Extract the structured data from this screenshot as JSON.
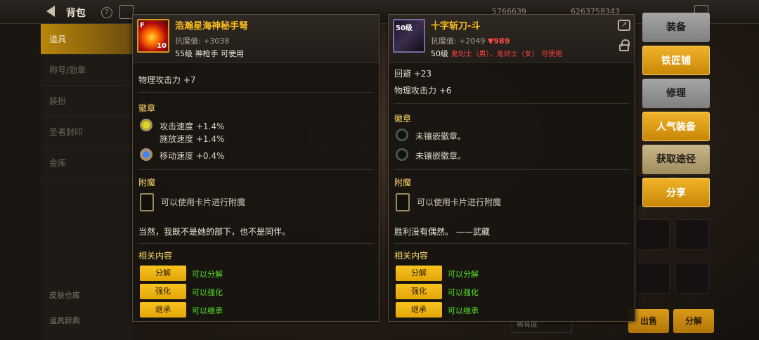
{
  "topbar": {
    "title": "背包",
    "help_label": "?",
    "currency_1": "5766639",
    "currency_2": "6263758343"
  },
  "leftnav": {
    "items": [
      "道具",
      "称号/勋章",
      "装扮",
      "圣者封印",
      "金库"
    ],
    "active_index": 0,
    "bottom_1": "皮肤仓库",
    "bottom_2": "道具辞典"
  },
  "background": {
    "sort_label": "稀有度",
    "sell_label": "出售",
    "decompose_label": "分解"
  },
  "left_item": {
    "name": "浩瀚星海神秘手弩",
    "icon_badge": "F",
    "icon_corner": "10",
    "stat": "抗魔值: +3038",
    "requirement": "55级 神枪手 可使用",
    "attr_1": "物理攻击力 +7",
    "emblem_title": "徽章",
    "emblem_1": "攻击速度 +1.4%",
    "emblem_1b": "施放速度 +1.4%",
    "emblem_2": "移动速度 +0.4%",
    "enchant_title": "附魔",
    "enchant_text": "可以使用卡片进行附魔",
    "quote": "当然，我既不是她的部下，也不是同伴。",
    "related_title": "相关内容",
    "related": [
      {
        "btn": "分解",
        "text": "可以分解"
      },
      {
        "btn": "强化",
        "text": "可以强化"
      },
      {
        "btn": "继承",
        "text": "可以继承"
      }
    ]
  },
  "right_item": {
    "name": "十字斩刀-斗",
    "icon_badge": "50级",
    "stat": "抗魔值: +2049",
    "stat_down": "▼989",
    "requirement_level": "50级",
    "requirement_class": "鬼剑士（男），鬼剑士（女）",
    "requirement_suffix": "可使用",
    "attr_1": "回避 +23",
    "attr_2": "物理攻击力 +6",
    "emblem_title": "徽章",
    "emblem_1": "未镶嵌徽章。",
    "emblem_2": "未镶嵌徽章。",
    "enchant_title": "附魔",
    "enchant_text": "可以使用卡片进行附魔",
    "quote": "胜利没有偶然。 ——武藏",
    "related_title": "相关内容",
    "related": [
      {
        "btn": "分解",
        "text": "可以分解"
      },
      {
        "btn": "强化",
        "text": "可以强化"
      },
      {
        "btn": "继承",
        "text": "可以继承"
      }
    ]
  },
  "actions": [
    "装备",
    "铁匠铺",
    "修理",
    "人气装备",
    "获取途径",
    "分享"
  ]
}
